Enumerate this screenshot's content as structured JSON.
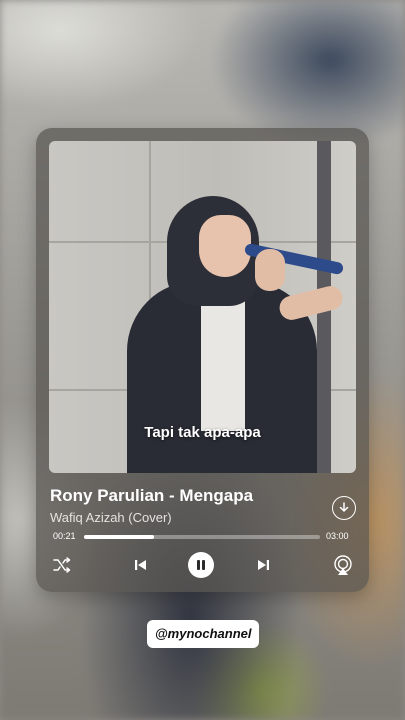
{
  "player": {
    "lyric": "Tapi tak apa-apa",
    "song_title": "Rony Parulian - Mengapa",
    "artist": "Wafiq Azizah (Cover)",
    "time_current": "00:21",
    "time_total": "03:00",
    "progress": 0.295,
    "icons": {
      "download": "download-circle-icon",
      "shuffle": "shuffle-icon",
      "previous": "skip-previous-icon",
      "pause": "pause-icon",
      "next": "skip-next-icon",
      "airplay": "airplay-icon"
    }
  },
  "watermark": {
    "channel": "@mynochannel"
  },
  "colors": {
    "card_background": "#58544f",
    "accent": "#ffffff",
    "microphone": "#2d4a8a"
  }
}
